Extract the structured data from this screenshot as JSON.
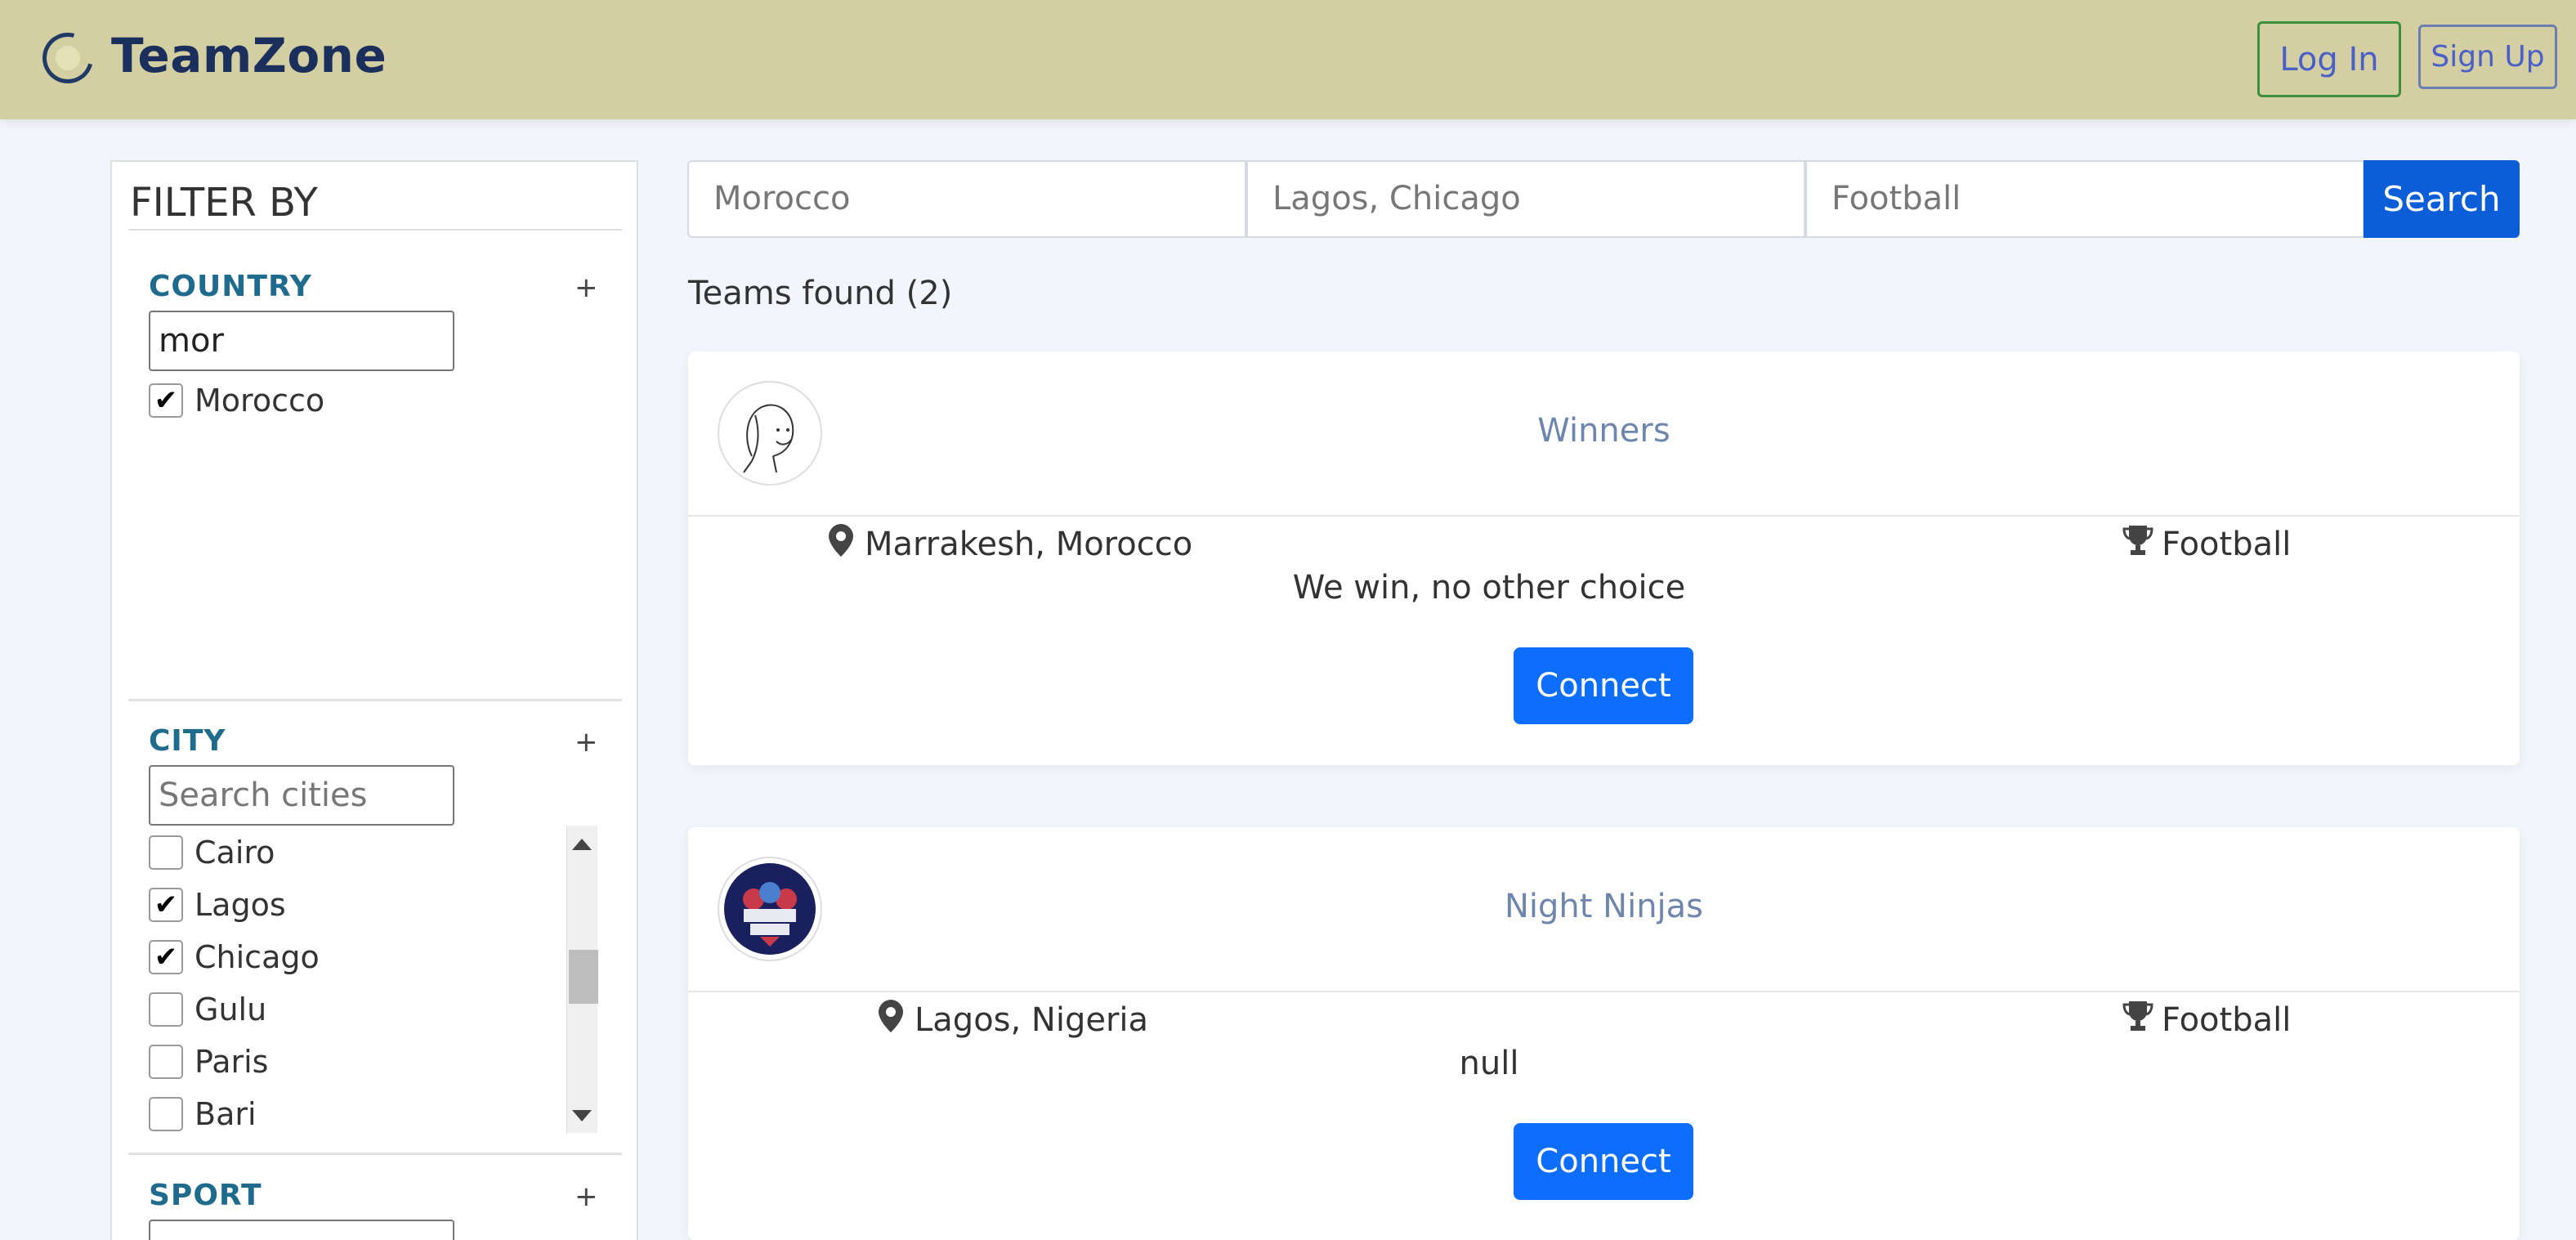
{
  "header": {
    "brand": "TeamZone",
    "login_label": "Log In",
    "signup_label": "Sign Up",
    "background_color": "#d3cfa3"
  },
  "sidebar": {
    "title": "FILTER BY",
    "country": {
      "label": "COUNTRY",
      "toggle": "+",
      "search_value": "mor",
      "options": [
        {
          "label": "Morocco",
          "checked": true
        }
      ]
    },
    "city": {
      "label": "CITY",
      "toggle": "+",
      "placeholder": "Search cities",
      "options": [
        {
          "label": "Cairo",
          "checked": false
        },
        {
          "label": "Lagos",
          "checked": true
        },
        {
          "label": "Chicago",
          "checked": true
        },
        {
          "label": "Gulu",
          "checked": false
        },
        {
          "label": "Paris",
          "checked": false
        },
        {
          "label": "Bari",
          "checked": false
        }
      ]
    },
    "sport": {
      "label": "SPORT",
      "toggle": "+"
    }
  },
  "search": {
    "country_value": "Morocco",
    "city_value": "Lagos, Chicago",
    "sport_value": "Football",
    "button_label": "Search"
  },
  "results": {
    "count_text": "Teams found (2)",
    "teams": [
      {
        "name": "Winners",
        "location": "Marrakesh, Morocco",
        "sport": "Football",
        "description": "We win, no other choice",
        "connect_label": "Connect",
        "avatar_icon": "sketch-face-avatar"
      },
      {
        "name": "Night Ninjas",
        "location": "Lagos, Nigeria",
        "sport": "Football",
        "description": "null",
        "connect_label": "Connect",
        "avatar_icon": "team-badge-avatar"
      }
    ]
  },
  "colors": {
    "accent": "#0d6efd",
    "section_label": "#1f6b8e",
    "team_name": "#6e86ad"
  }
}
